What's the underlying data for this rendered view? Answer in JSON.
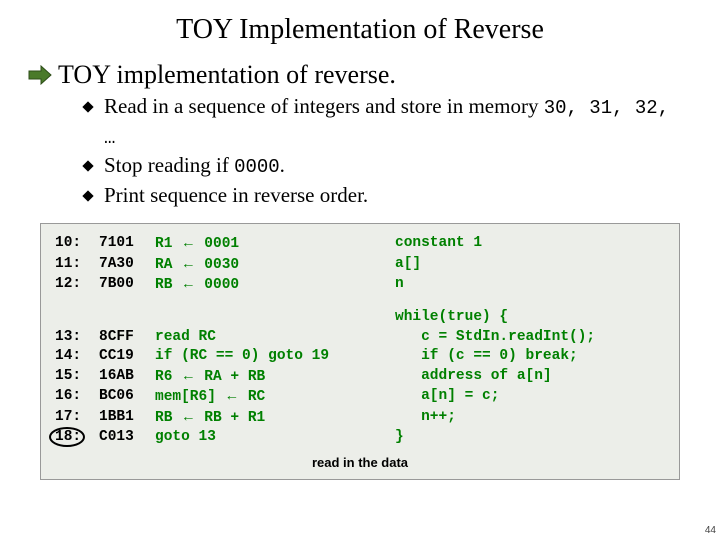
{
  "title": "TOY Implementation of Reverse",
  "subtitle": "TOY implementation of reverse.",
  "bullets": [
    {
      "pre": "Read in a sequence of integers and store in memory ",
      "mono": "30, 31, 32, …",
      "post": ""
    },
    {
      "pre": "Stop reading if ",
      "mono": "0000",
      "post": "."
    },
    {
      "pre": "Print sequence in reverse order.",
      "mono": "",
      "post": ""
    }
  ],
  "block1": {
    "rows": [
      {
        "addr": "10:",
        "hex": "7101",
        "desc_a": "R1 ",
        "desc_b": " 0001",
        "c": "constant 1"
      },
      {
        "addr": "11:",
        "hex": "7A30",
        "desc_a": "RA ",
        "desc_b": " 0030",
        "c": "a[]"
      },
      {
        "addr": "12:",
        "hex": "7B00",
        "desc_a": "RB ",
        "desc_b": " 0000",
        "c": "n"
      }
    ]
  },
  "block2": {
    "c_lines": [
      "while(true) {",
      "   c = StdIn.readInt();",
      "   if (c == 0) break;",
      "   address of a[n]",
      "   a[n] = c;",
      "   n++;",
      "}"
    ],
    "rows": [
      {
        "addr": "13:",
        "hex": "8CFF",
        "desc_plain": "read RC",
        "circled": false
      },
      {
        "addr": "14:",
        "hex": "CC19",
        "desc_plain": "if (RC == 0) goto 19",
        "circled": false
      },
      {
        "addr": "15:",
        "hex": "16AB",
        "desc_a": "R6 ",
        "desc_b": " RA + RB",
        "circled": false
      },
      {
        "addr": "16:",
        "hex": "BC06",
        "desc_a": "mem[R6] ",
        "desc_b": " RC",
        "circled": false
      },
      {
        "addr": "17:",
        "hex": "1BB1",
        "desc_a": "RB ",
        "desc_b": " RB + R1",
        "circled": false
      },
      {
        "addr": "18:",
        "hex": "C013",
        "desc_plain": "goto 13",
        "circled": true
      }
    ]
  },
  "caption": "read in the data",
  "arrow_glyph": "←",
  "pagenum": "44"
}
